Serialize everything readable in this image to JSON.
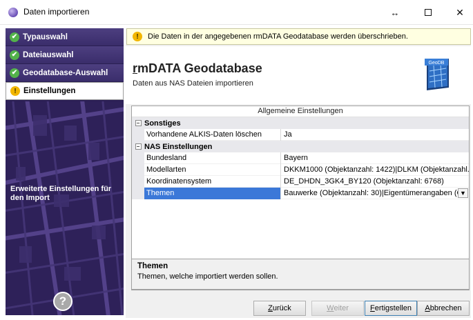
{
  "window": {
    "title": "Daten importieren",
    "resize_glyph": "↔",
    "maximize_glyph": "",
    "close_glyph": "✕"
  },
  "sidebar": {
    "steps": [
      {
        "label": "Typauswahl",
        "status": "done"
      },
      {
        "label": "Dateiauswahl",
        "status": "done"
      },
      {
        "label": "Geodatabase-Auswahl",
        "status": "done"
      },
      {
        "label": "Einstellungen",
        "status": "current"
      }
    ],
    "description": "Erweiterte Einstellungen für den Import",
    "help_glyph": "?"
  },
  "info": {
    "message": "Die Daten in der angegebenen rmDATA Geodatabase werden überschrieben."
  },
  "header": {
    "title_accel": "r",
    "title_rest": "mDATA Geodatabase",
    "subtitle": "Daten aus NAS Dateien importieren",
    "logo_label": "GeoDB"
  },
  "grid": {
    "heading": "Allgemeine Einstellungen",
    "categories": [
      {
        "name": "Sonstiges",
        "rows": [
          {
            "name": "Vorhandene ALKIS-Daten löschen",
            "value": "Ja"
          }
        ]
      },
      {
        "name": "NAS Einstellungen",
        "rows": [
          {
            "name": "Bundesland",
            "value": "Bayern"
          },
          {
            "name": "Modellarten",
            "value": "DKKM1000 (Objektanzahl: 1422)|DLKM (Objektanzahl..."
          },
          {
            "name": "Koordinatensystem",
            "value": "DE_DHDN_3GK4_BY120 (Objektanzahl: 6768)"
          },
          {
            "name": "Themen",
            "value": "Bauwerke (Objektanzahl: 30)|Eigentümerangaben (Ol"
          }
        ]
      }
    ]
  },
  "description": {
    "title": "Themen",
    "text": "Themen, welche importiert werden sollen."
  },
  "buttons": {
    "back": {
      "accel": "Z",
      "rest": "urück"
    },
    "next": {
      "accel": "W",
      "rest": "eiter"
    },
    "finish": {
      "accel": "F",
      "rest": "ertigstellen"
    },
    "cancel": {
      "accel": "A",
      "rest": "bbrechen"
    }
  }
}
